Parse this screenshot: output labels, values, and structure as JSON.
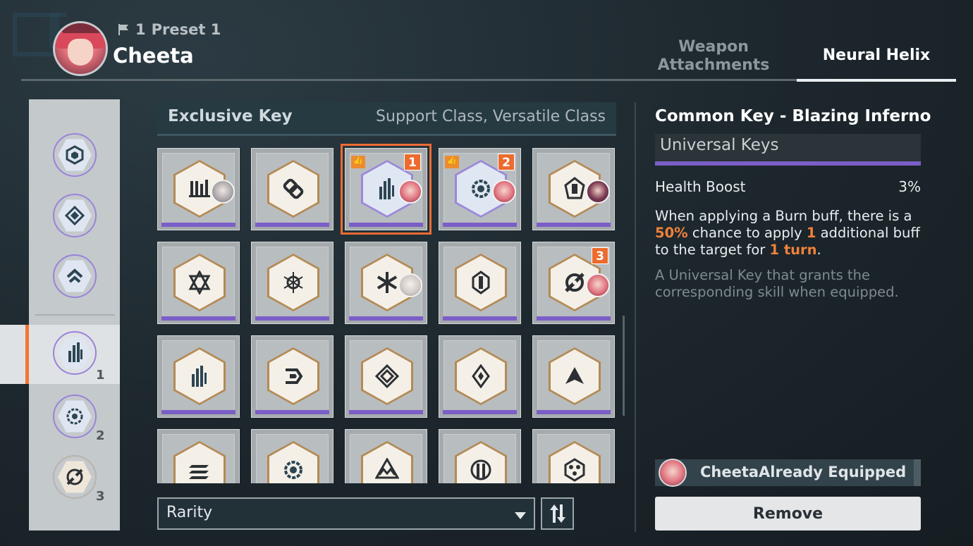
{
  "header": {
    "preset_number": "1",
    "preset_label": "Preset 1",
    "character_name": "Cheeta",
    "tabs": [
      {
        "label": "Weapon Attachments",
        "active": false
      },
      {
        "label": "Neural Helix",
        "active": true
      }
    ]
  },
  "sidebar": {
    "slots": [
      {
        "icon": "crosshair-hex-key-icon",
        "number": ""
      },
      {
        "icon": "diamond-key-icon",
        "number": ""
      },
      {
        "icon": "chevron-key-icon",
        "number": ""
      },
      {
        "icon": "blaze-key-icon",
        "number": "1",
        "selected": true
      },
      {
        "icon": "gear-eye-key-icon",
        "number": "2"
      },
      {
        "icon": "slash-orb-key-icon",
        "number": "3"
      }
    ]
  },
  "panel": {
    "title": "Exclusive Key",
    "classes": "Support Class, Versatile Class"
  },
  "keys": [
    {
      "icon": "bars-key-icon",
      "avatar": "grey",
      "rank": "",
      "recommended": false,
      "tone": "warm"
    },
    {
      "icon": "knot-key-icon",
      "avatar": "",
      "rank": "",
      "recommended": false,
      "tone": "warm"
    },
    {
      "icon": "blaze-key-icon",
      "avatar": "pink",
      "rank": "1",
      "recommended": true,
      "tone": "cool",
      "selected": true
    },
    {
      "icon": "gear-eye-key-icon",
      "avatar": "pink",
      "rank": "2",
      "recommended": true,
      "tone": "cool"
    },
    {
      "icon": "crest-key-icon",
      "avatar": "dark",
      "rank": "",
      "recommended": false,
      "tone": "warm"
    },
    {
      "icon": "hexagram-key-icon",
      "avatar": "",
      "rank": "",
      "recommended": false,
      "tone": "warm"
    },
    {
      "icon": "flake-ring-key-icon",
      "avatar": "",
      "rank": "",
      "recommended": false,
      "tone": "warm"
    },
    {
      "icon": "snowflake-key-icon",
      "avatar": "white",
      "rank": "",
      "recommended": false,
      "tone": "warm"
    },
    {
      "icon": "pillar-key-icon",
      "avatar": "",
      "rank": "",
      "recommended": false,
      "tone": "warm"
    },
    {
      "icon": "slash-orb-key-icon",
      "avatar": "pink",
      "rank": "3",
      "recommended": false,
      "tone": "warm"
    },
    {
      "icon": "blaze-key-icon",
      "avatar": "",
      "rank": "",
      "recommended": false,
      "tone": "warm"
    },
    {
      "icon": "swirl-key-icon",
      "avatar": "",
      "rank": "",
      "recommended": false,
      "tone": "warm"
    },
    {
      "icon": "layered-diamond-key-icon",
      "avatar": "",
      "rank": "",
      "recommended": false,
      "tone": "warm"
    },
    {
      "icon": "rhombus-key-icon",
      "avatar": "",
      "rank": "",
      "recommended": false,
      "tone": "warm"
    },
    {
      "icon": "arrowhead-key-icon",
      "avatar": "",
      "rank": "",
      "recommended": false,
      "tone": "warm"
    },
    {
      "icon": "stripes-key-icon",
      "avatar": "",
      "rank": "",
      "recommended": false,
      "tone": "warm"
    },
    {
      "icon": "gear-eye-key-icon",
      "avatar": "",
      "rank": "",
      "recommended": false,
      "tone": "warm"
    },
    {
      "icon": "triangle-wave-key-icon",
      "avatar": "",
      "rank": "",
      "recommended": false,
      "tone": "warm"
    },
    {
      "icon": "gate-key-icon",
      "avatar": "",
      "rank": "",
      "recommended": false,
      "tone": "warm"
    },
    {
      "icon": "lattice-key-icon",
      "avatar": "",
      "rank": "",
      "recommended": false,
      "tone": "warm"
    }
  ],
  "filter": {
    "label": "Rarity",
    "sort_icon": "sort-arrows-icon"
  },
  "detail": {
    "title": "Common Key - Blazing Inferno",
    "category": "Universal Keys",
    "stat_name": "Health Boost",
    "stat_value": "3%",
    "desc_1": "When applying a Burn buff, there is a ",
    "desc_chance": "50%",
    "desc_2": " chance to apply ",
    "desc_count": "1",
    "desc_3": " additional buff to the target for ",
    "desc_duration": "1 turn",
    "desc_4": ".",
    "flavor": "A Universal Key that grants the corresponding skill when equipped.",
    "equipped_text": "CheetaAlready Equipped",
    "remove_label": "Remove"
  },
  "colors": {
    "accent": "#ec6b2e",
    "rarity_bar": "#7b5ec7",
    "highlight": "#f0813a"
  }
}
